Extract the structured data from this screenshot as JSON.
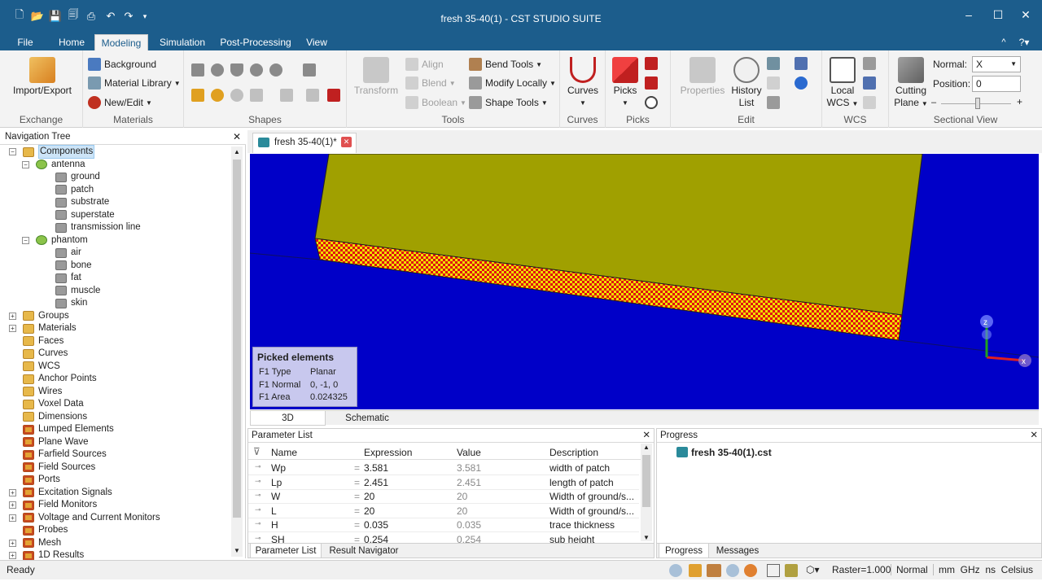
{
  "window": {
    "title": "fresh 35-40(1) - CST STUDIO SUITE"
  },
  "menu": {
    "file": "File",
    "tabs": [
      "Home",
      "Modeling",
      "Simulation",
      "Post-Processing",
      "View"
    ],
    "active": "Modeling"
  },
  "ribbon": {
    "exchange": {
      "label": "Exchange",
      "import_export": "Import/Export"
    },
    "materials": {
      "label": "Materials",
      "background": "Background",
      "material_library": "Material Library",
      "new_edit": "New/Edit"
    },
    "shapes": {
      "label": "Shapes"
    },
    "tools": {
      "label": "Tools",
      "transform": "Transform",
      "align": "Align",
      "blend": "Blend",
      "boolean": "Boolean",
      "bend_tools": "Bend Tools",
      "modify_locally": "Modify Locally",
      "shape_tools": "Shape Tools"
    },
    "curves": {
      "label": "Curves",
      "curves": "Curves"
    },
    "picks": {
      "label": "Picks",
      "picks": "Picks"
    },
    "edit": {
      "label": "Edit",
      "properties": "Properties",
      "history_list_1": "History",
      "history_list_2": "List"
    },
    "wcs": {
      "label": "WCS",
      "local_1": "Local",
      "local_2": "WCS"
    },
    "sectional": {
      "label": "Sectional View",
      "cutting_1": "Cutting",
      "cutting_2": "Plane",
      "normal_label": "Normal:",
      "normal_value": "X",
      "position_label": "Position:",
      "position_value": "0"
    }
  },
  "nav": {
    "title": "Navigation Tree",
    "components": "Components",
    "antenna": "antenna",
    "antenna_children": [
      "ground",
      "patch",
      "substrate",
      "superstate",
      "transmission line"
    ],
    "phantom": "phantom",
    "phantom_children": [
      "air",
      "bone",
      "fat",
      "muscle",
      "skin"
    ],
    "top_items": [
      "Groups",
      "Materials",
      "Faces",
      "Curves",
      "WCS",
      "Anchor Points",
      "Wires",
      "Voxel Data",
      "Dimensions",
      "Lumped Elements",
      "Plane Wave",
      "Farfield Sources",
      "Field Sources",
      "Ports",
      "Excitation Signals",
      "Field Monitors",
      "Voltage and Current Monitors",
      "Probes",
      "Mesh",
      "1D Results"
    ]
  },
  "doc": {
    "tab": "fresh 35-40(1)*"
  },
  "picked": {
    "title": "Picked elements",
    "rows": [
      {
        "k": "F1 Type",
        "v": "Planar"
      },
      {
        "k": "F1 Normal",
        "v": "0, -1, 0"
      },
      {
        "k": "F1 Area",
        "v": "0.024325"
      }
    ]
  },
  "axes": {
    "z": "z",
    "x": "x"
  },
  "view_tabs": [
    "3D",
    "Schematic"
  ],
  "params": {
    "title": "Parameter List",
    "headers": [
      "Name",
      "Expression",
      "Value",
      "Description"
    ],
    "rows": [
      {
        "name": "Wp",
        "expr": "3.581",
        "value": "3.581",
        "desc": "width of patch"
      },
      {
        "name": "Lp",
        "expr": "2.451",
        "value": "2.451",
        "desc": "length of patch"
      },
      {
        "name": "W",
        "expr": "20",
        "value": "20",
        "desc": "Width of ground/s..."
      },
      {
        "name": "L",
        "expr": "20",
        "value": "20",
        "desc": "Width of ground/s..."
      },
      {
        "name": "H",
        "expr": "0.035",
        "value": "0.035",
        "desc": "trace thickness"
      },
      {
        "name": "SH",
        "expr": "0.254",
        "value": "0.254",
        "desc": "sub height"
      }
    ],
    "tabs": [
      "Parameter List",
      "Result Navigator"
    ]
  },
  "progress": {
    "title": "Progress",
    "file": "fresh 35-40(1).cst",
    "tabs": [
      "Progress",
      "Messages"
    ]
  },
  "status": {
    "ready": "Ready",
    "raster": "Raster=1.000",
    "mode": "Normal",
    "units": "mm  GHz  ns  Celsius"
  },
  "colors": {
    "chrome": "#1c5d8c",
    "viewport_bg": "#0000c8",
    "substrate": "#a0a000",
    "patch_red": "#e01010",
    "patch_yellow": "#f0e000"
  }
}
